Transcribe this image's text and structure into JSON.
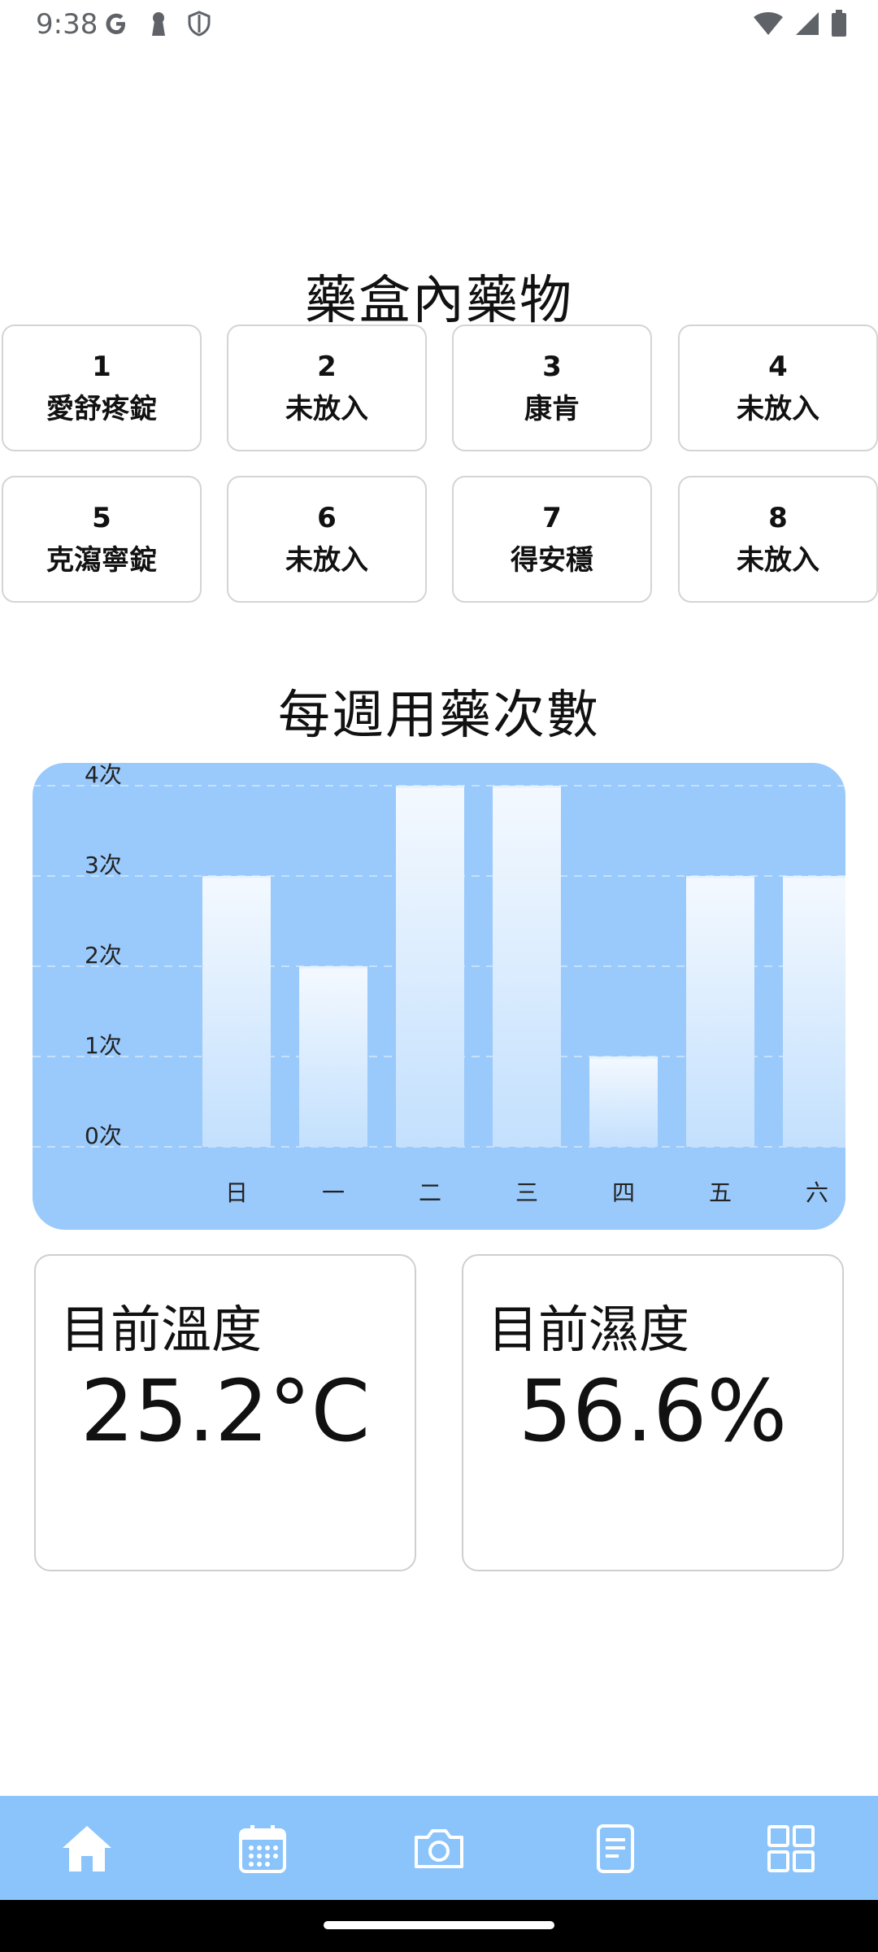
{
  "status_bar": {
    "time": "9:38",
    "left_icons": [
      "google-icon",
      "keyhole-icon",
      "shield-icon"
    ],
    "right_icons": [
      "wifi-icon",
      "signal-icon",
      "battery-icon"
    ]
  },
  "pillbox": {
    "title": "藥盒內藥物",
    "slots": [
      {
        "number": "1",
        "name": "愛舒疼錠"
      },
      {
        "number": "2",
        "name": "未放入"
      },
      {
        "number": "3",
        "name": "康肯"
      },
      {
        "number": "4",
        "name": "未放入"
      },
      {
        "number": "5",
        "name": "克瀉寧錠"
      },
      {
        "number": "6",
        "name": "未放入"
      },
      {
        "number": "7",
        "name": "得安穩"
      },
      {
        "number": "8",
        "name": "未放入"
      }
    ]
  },
  "weekly": {
    "title": "每週用藥次數"
  },
  "chart_data": {
    "type": "bar",
    "categories": [
      "日",
      "一",
      "二",
      "三",
      "四",
      "五",
      "六"
    ],
    "values": [
      3,
      2,
      4,
      4,
      1,
      3,
      3
    ],
    "y_ticks": [
      "0次",
      "1次",
      "2次",
      "3次",
      "4次"
    ],
    "ylim": [
      0,
      4
    ],
    "grid": true,
    "colors": {
      "background": "#9ac9fb",
      "bar_top": "#f4f9ff",
      "bar_bottom": "#c3e0fd"
    }
  },
  "environment": {
    "temperature_label": "目前溫度",
    "temperature_value": "25.2°C",
    "humidity_label": "目前濕度",
    "humidity_value": "56.6%"
  },
  "bottom_nav": {
    "items": [
      "home-icon",
      "calendar-icon",
      "camera-icon",
      "document-icon",
      "grid-icon"
    ],
    "background": "#8bc4fb"
  }
}
